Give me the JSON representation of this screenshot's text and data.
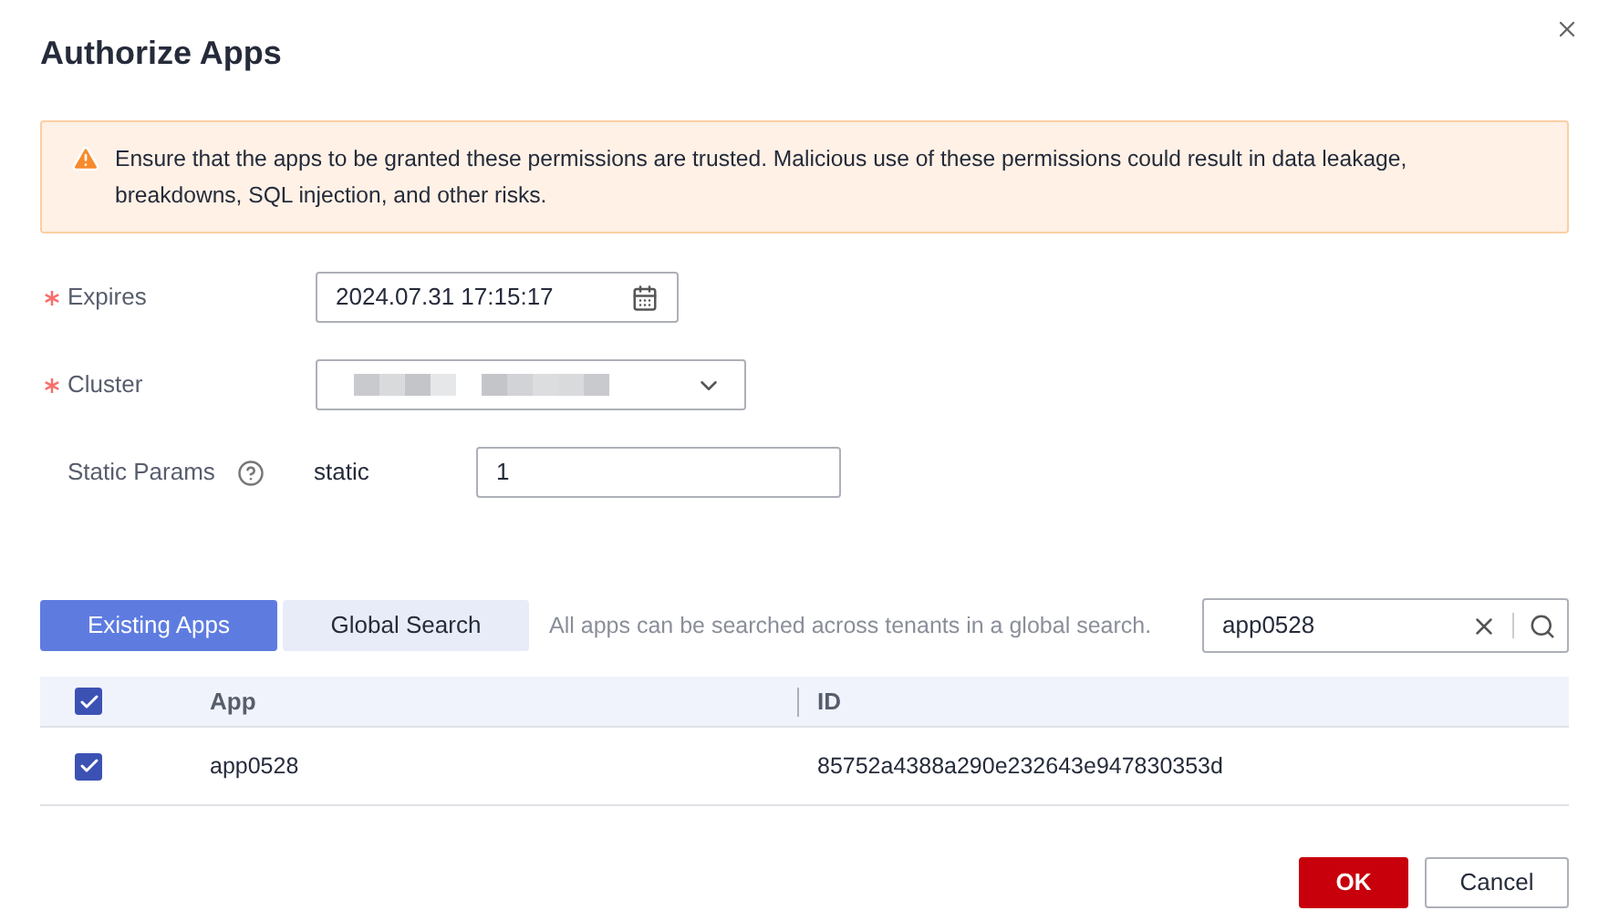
{
  "dialog": {
    "title": "Authorize Apps"
  },
  "alert": {
    "text": "Ensure that the apps to be granted these permissions are trusted. Malicious use of these permissions could result in data leakage, breakdowns, SQL injection, and other risks."
  },
  "form": [
    {
      "kind": "date",
      "label": "Expires",
      "required": true,
      "value": "2024.07.31 17:15:17"
    },
    {
      "kind": "select",
      "label": "Cluster",
      "required": true
    },
    {
      "kind": "param",
      "label": "Static Params",
      "required": false,
      "key": "static",
      "value": "1"
    }
  ],
  "tabs": [
    {
      "label": "Existing Apps",
      "selected": true
    },
    {
      "label": "Global Search",
      "selected": false
    }
  ],
  "tab_hint": "All apps can be searched across tenants in a global search.",
  "search": {
    "value": "app0528"
  },
  "table": {
    "all_checked": true,
    "columns": [
      "App",
      "ID"
    ],
    "rows": [
      {
        "checked": true,
        "app": "app0528",
        "id": "85752a4388a290e232643e947830353d"
      }
    ]
  },
  "buttons": [
    {
      "label": "OK",
      "kind": "primary"
    },
    {
      "label": "Cancel",
      "kind": "secondary"
    }
  ]
}
